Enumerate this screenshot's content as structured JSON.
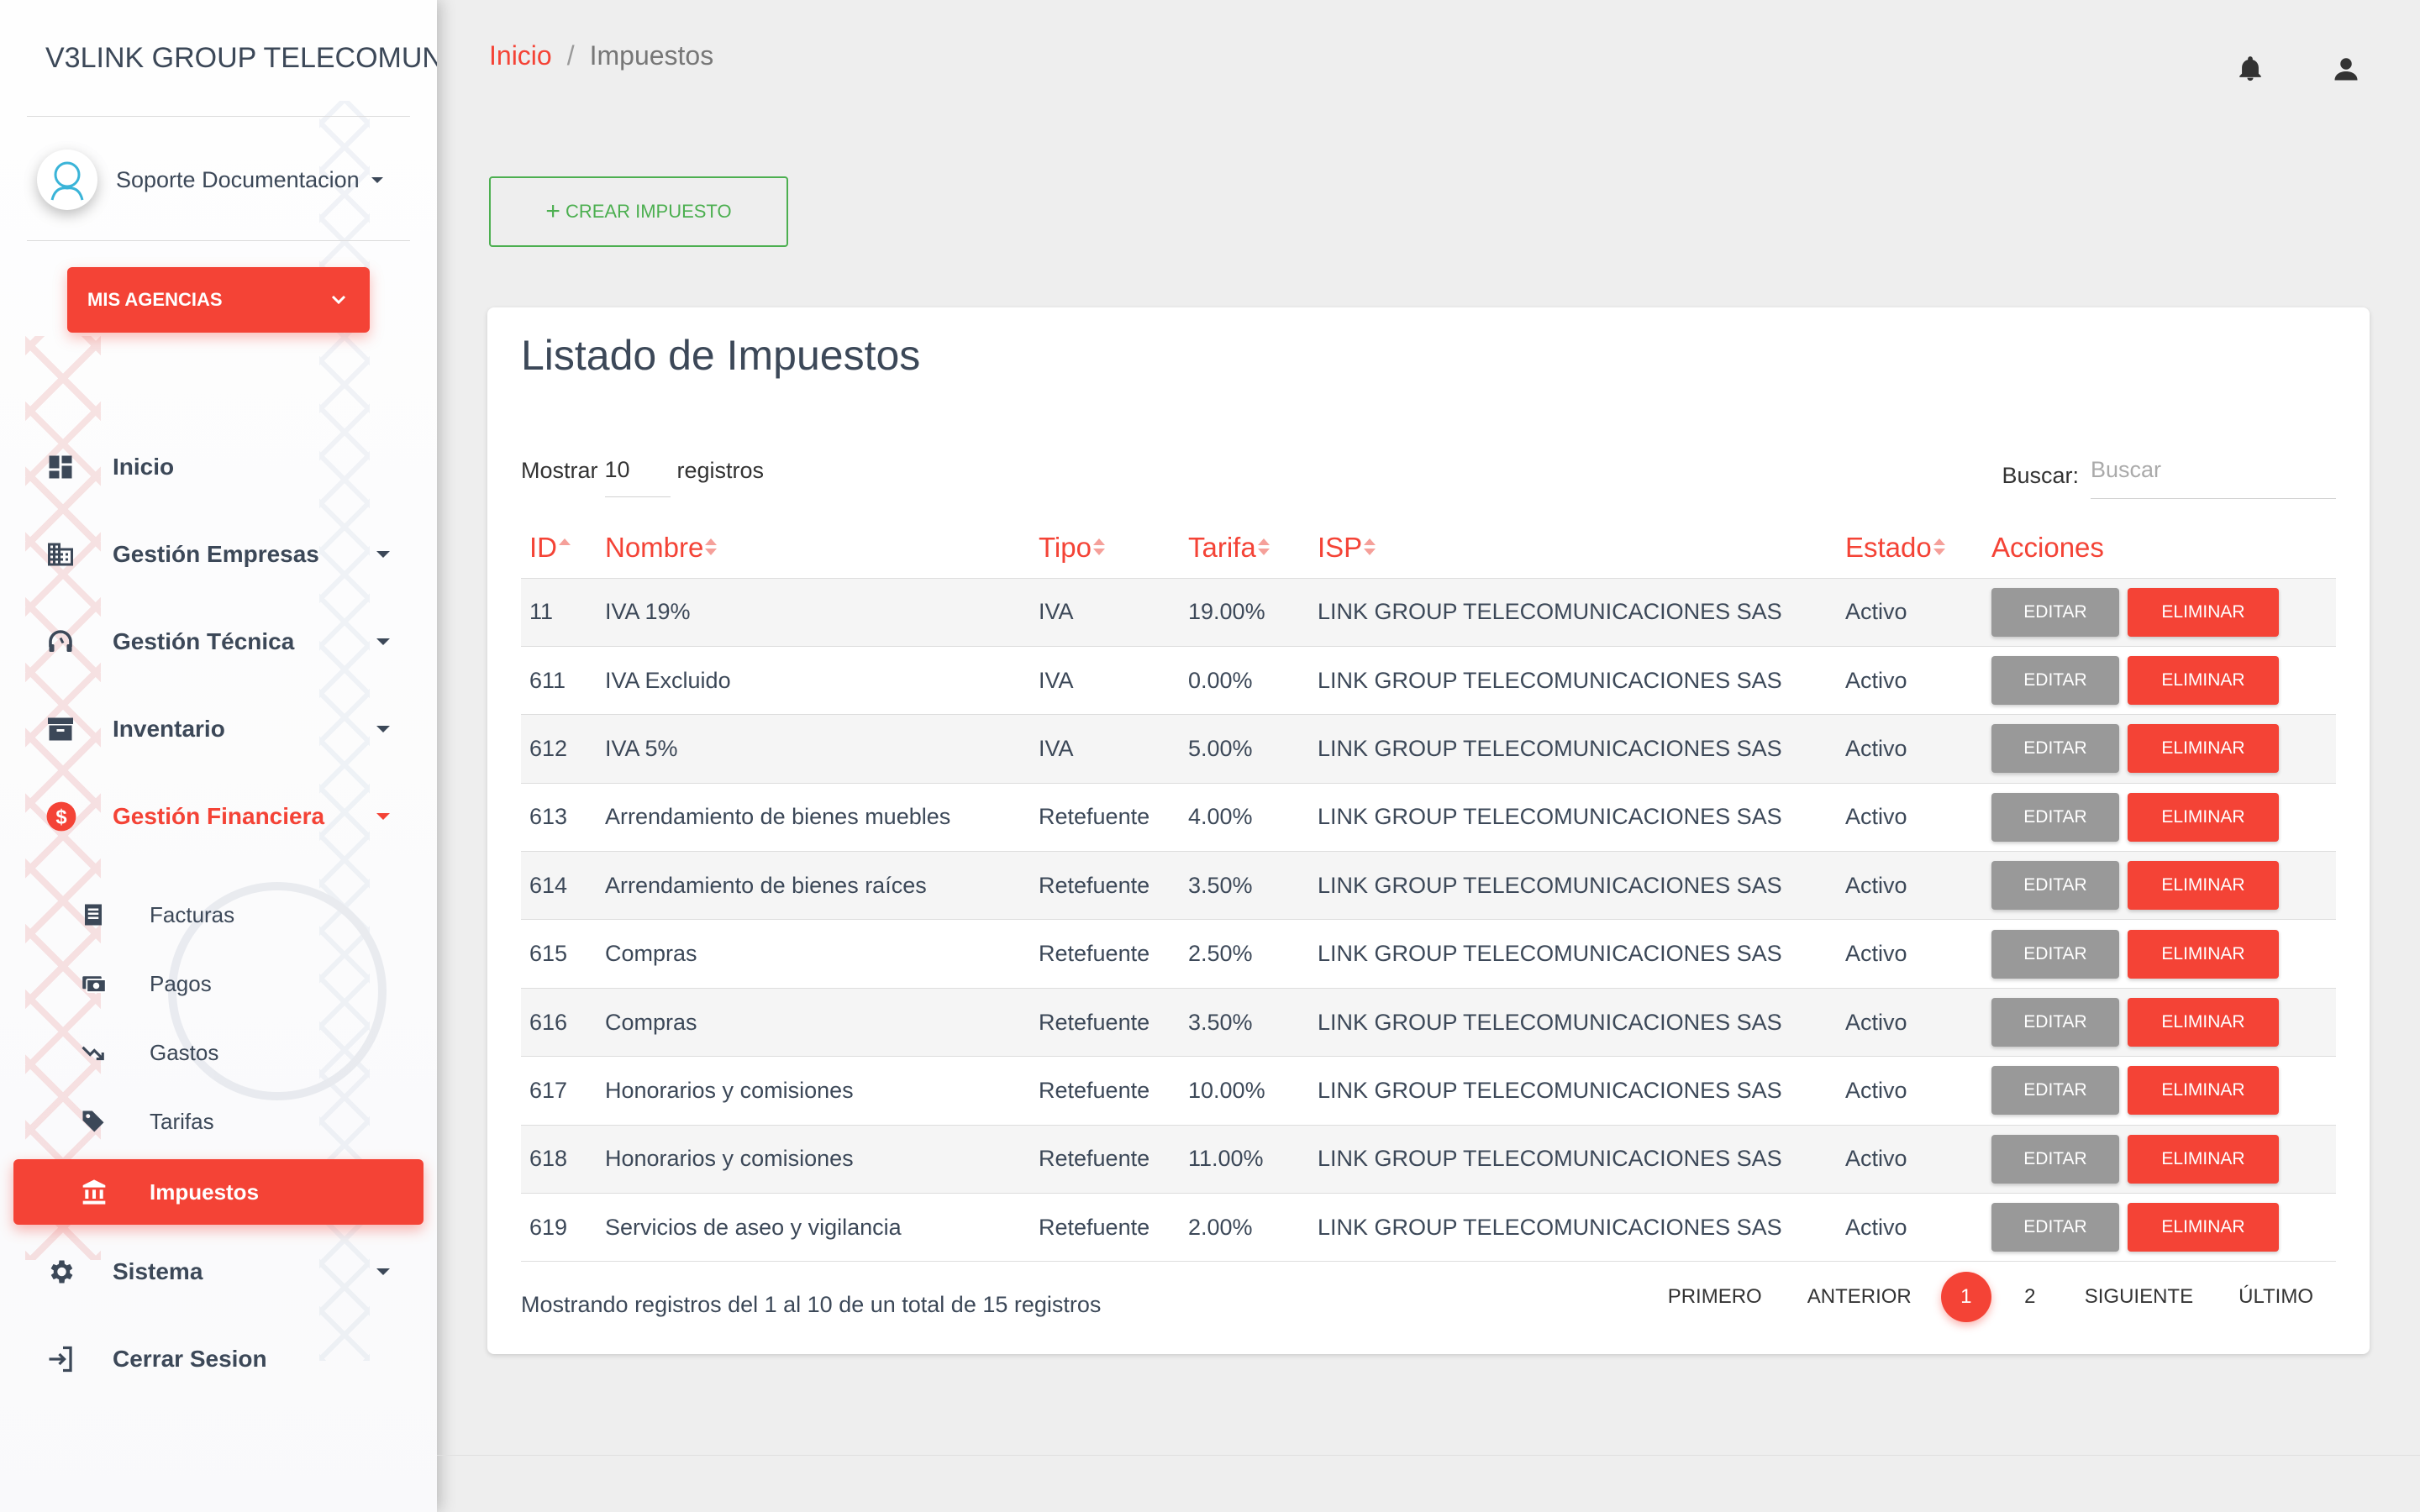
{
  "brand": {
    "mini": "V3",
    "name": "LINK GROUP TELECOMUNICACIONES SAS"
  },
  "user": {
    "name": "Soporte Documentacion"
  },
  "agencies_button": "MIS AGENCIAS",
  "nav": {
    "inicio": "Inicio",
    "empresas": "Gestión Empresas",
    "tecnica": "Gestión Técnica",
    "inventario": "Inventario",
    "financiera": "Gestión Financiera",
    "sub": {
      "facturas": "Facturas",
      "pagos": "Pagos",
      "gastos": "Gastos",
      "tarifas": "Tarifas",
      "impuestos": "Impuestos"
    },
    "sistema": "Sistema",
    "cerrar": "Cerrar Sesion"
  },
  "breadcrumb": {
    "home": "Inicio",
    "separator": "/",
    "current": "Impuestos"
  },
  "create_button": {
    "icon": "+",
    "label": "CREAR IMPUESTO"
  },
  "card": {
    "title": "Listado de Impuestos",
    "show_prefix": "Mostrar",
    "show_value": "10",
    "show_suffix": "registros",
    "search_label": "Buscar:",
    "search_placeholder": "Buscar"
  },
  "table": {
    "headers": {
      "id": "ID",
      "nombre": "Nombre",
      "tipo": "Tipo",
      "tarifa": "Tarifa",
      "isp": "ISP",
      "estado": "Estado",
      "acciones": "Acciones"
    },
    "edit_label": "EDITAR",
    "delete_label": "ELIMINAR",
    "rows": [
      {
        "id": "11",
        "nombre": "IVA 19%",
        "tipo": "IVA",
        "tarifa": "19.00%",
        "isp": "LINK GROUP TELECOMUNICACIONES SAS",
        "estado": "Activo"
      },
      {
        "id": "611",
        "nombre": "IVA Excluido",
        "tipo": "IVA",
        "tarifa": "0.00%",
        "isp": "LINK GROUP TELECOMUNICACIONES SAS",
        "estado": "Activo"
      },
      {
        "id": "612",
        "nombre": "IVA 5%",
        "tipo": "IVA",
        "tarifa": "5.00%",
        "isp": "LINK GROUP TELECOMUNICACIONES SAS",
        "estado": "Activo"
      },
      {
        "id": "613",
        "nombre": "Arrendamiento de bienes muebles",
        "tipo": "Retefuente",
        "tarifa": "4.00%",
        "isp": "LINK GROUP TELECOMUNICACIONES SAS",
        "estado": "Activo"
      },
      {
        "id": "614",
        "nombre": "Arrendamiento de bienes raíces",
        "tipo": "Retefuente",
        "tarifa": "3.50%",
        "isp": "LINK GROUP TELECOMUNICACIONES SAS",
        "estado": "Activo"
      },
      {
        "id": "615",
        "nombre": "Compras",
        "tipo": "Retefuente",
        "tarifa": "2.50%",
        "isp": "LINK GROUP TELECOMUNICACIONES SAS",
        "estado": "Activo"
      },
      {
        "id": "616",
        "nombre": "Compras",
        "tipo": "Retefuente",
        "tarifa": "3.50%",
        "isp": "LINK GROUP TELECOMUNICACIONES SAS",
        "estado": "Activo"
      },
      {
        "id": "617",
        "nombre": "Honorarios y comisiones",
        "tipo": "Retefuente",
        "tarifa": "10.00%",
        "isp": "LINK GROUP TELECOMUNICACIONES SAS",
        "estado": "Activo"
      },
      {
        "id": "618",
        "nombre": "Honorarios y comisiones",
        "tipo": "Retefuente",
        "tarifa": "11.00%",
        "isp": "LINK GROUP TELECOMUNICACIONES SAS",
        "estado": "Activo"
      },
      {
        "id": "619",
        "nombre": "Servicios de aseo y vigilancia",
        "tipo": "Retefuente",
        "tarifa": "2.00%",
        "isp": "LINK GROUP TELECOMUNICACIONES SAS",
        "estado": "Activo"
      }
    ]
  },
  "info": "Mostrando registros del 1 al 10 de un total de 15 registros",
  "pagination": {
    "first": "PRIMERO",
    "prev": "ANTERIOR",
    "pages": [
      "1",
      "2"
    ],
    "current_page": "1",
    "next": "SIGUIENTE",
    "last": "ÚLTIMO"
  },
  "colors": {
    "accent": "#f44336",
    "success": "#4caf50",
    "edit": "#999999",
    "text": "#3c4858"
  }
}
